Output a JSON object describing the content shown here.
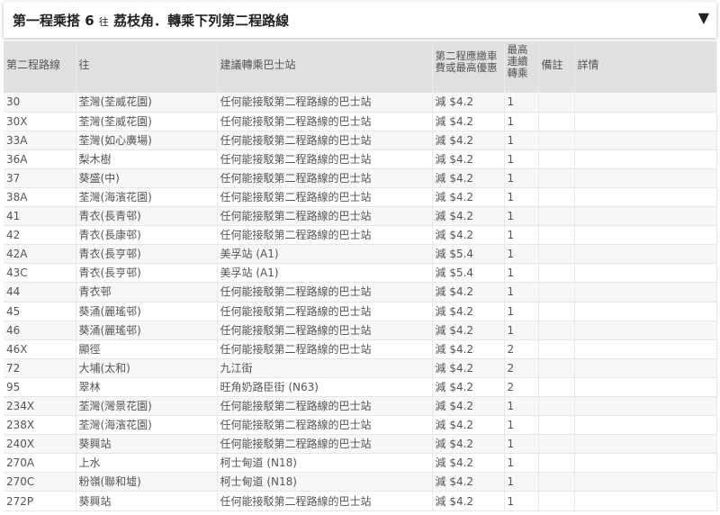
{
  "header": {
    "title_part1": "第一程乘搭 6 ",
    "title_small": "往",
    "title_part2": " 荔枝角．轉乘下列第二程路線",
    "toggle_symbol": "▼"
  },
  "table": {
    "columns": [
      "第二程路線",
      "往",
      "建議轉乘巴士站",
      "第二程應繳車費或最高優惠",
      "最高連續轉乘",
      "備註",
      "詳情"
    ],
    "rows": [
      [
        "30",
        "荃灣(荃威花園)",
        "任何能接駁第二程路線的巴士站",
        "減 $4.2",
        "1"
      ],
      [
        "30X",
        "荃灣(荃威花園)",
        "任何能接駁第二程路線的巴士站",
        "減 $4.2",
        "1"
      ],
      [
        "33A",
        "荃灣(如心廣場)",
        "任何能接駁第二程路線的巴士站",
        "減 $4.2",
        "1"
      ],
      [
        "36A",
        "梨木樹",
        "任何能接駁第二程路線的巴士站",
        "減 $4.2",
        "1"
      ],
      [
        "37",
        "葵盛(中)",
        "任何能接駁第二程路線的巴士站",
        "減 $4.2",
        "1"
      ],
      [
        "38A",
        "荃灣(海濱花園)",
        "任何能接駁第二程路線的巴士站",
        "減 $4.2",
        "1"
      ],
      [
        "41",
        "青衣(長青邨)",
        "任何能接駁第二程路線的巴士站",
        "減 $4.2",
        "1"
      ],
      [
        "42",
        "青衣(長康邨)",
        "任何能接駁第二程路線的巴士站",
        "減 $4.2",
        "1"
      ],
      [
        "42A",
        "青衣(長亨邨)",
        "美孚站 (A1)",
        "減 $5.4",
        "1"
      ],
      [
        "43C",
        "青衣(長亨邨)",
        "美孚站 (A1)",
        "減 $5.4",
        "1"
      ],
      [
        "44",
        "青衣邨",
        "任何能接駁第二程路線的巴士站",
        "減 $4.2",
        "1"
      ],
      [
        "45",
        "葵涌(麗瑤邨)",
        "任何能接駁第二程路線的巴士站",
        "減 $4.2",
        "1"
      ],
      [
        "46",
        "葵涌(麗瑤邨)",
        "任何能接駁第二程路線的巴士站",
        "減 $4.2",
        "1"
      ],
      [
        "46X",
        "顯徑",
        "任何能接駁第二程路線的巴士站",
        "減 $4.2",
        "2"
      ],
      [
        "72",
        "大埔(太和)",
        "九江街",
        "減 $4.2",
        "2"
      ],
      [
        "95",
        "翠林",
        "旺角奶路臣街 (N63)",
        "減 $4.2",
        "2"
      ],
      [
        "234X",
        "荃灣(灣景花園)",
        "任何能接駁第二程路線的巴士站",
        "減 $4.2",
        "1"
      ],
      [
        "238X",
        "荃灣(海濱花園)",
        "任何能接駁第二程路線的巴士站",
        "減 $4.2",
        "1"
      ],
      [
        "240X",
        "葵興站",
        "任何能接駁第二程路線的巴士站",
        "減 $4.2",
        "1"
      ],
      [
        "270A",
        "上水",
        "柯士甸道 (N18)",
        "減 $4.2",
        "1"
      ],
      [
        "270C",
        "粉嶺(聯和墟)",
        "柯士甸道 (N18)",
        "減 $4.2",
        "1"
      ],
      [
        "272P",
        "葵興站",
        "任何能接駁第二程路線的巴士站",
        "減 $4.2",
        "1"
      ]
    ]
  }
}
